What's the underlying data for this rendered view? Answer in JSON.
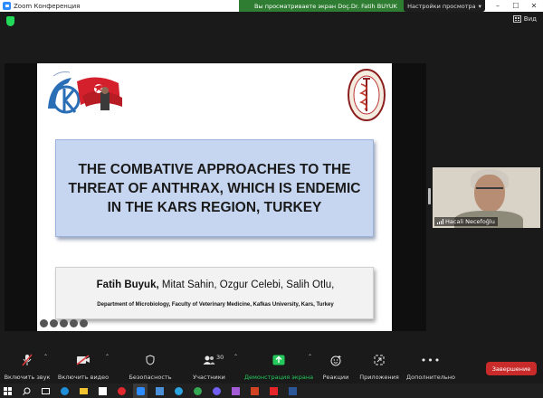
{
  "window": {
    "title": "Zoom Конференция",
    "share_banner": "Вы просматриваете экран Doç.Dr. Fatih BUYUK",
    "view_options": "Настройки просмотра",
    "view_button": "Вид"
  },
  "slide": {
    "title_lines": [
      "THE COMBATIVE APPROACHES TO THE",
      "THREAT OF ANTHRAX, WHICH IS ENDEMIC",
      "IN THE KARS REGION, TURKEY"
    ],
    "lead_author": "Fatih Buyuk,",
    "coauthors": " Mitat Sahin, Ozgur Celebi, Salih Otlu,",
    "department": "Department of Microbiology, Faculty of Veterinary Medicine, Kafkas University, Kars, Turkey"
  },
  "participant": {
    "name": "Hacali Necefoğlu"
  },
  "toolbar": {
    "audio": "Включить звук",
    "video": "Включить видео",
    "security": "Безопасность",
    "participants": "Участники",
    "participants_count": "30",
    "share": "Демонстрация экрана",
    "reactions": "Реакции",
    "apps": "Приложения",
    "more": "Дополнительно",
    "end": "Завершение"
  },
  "colors": {
    "share_green": "#2f7d32",
    "end_red": "#c92b2b",
    "title_box": "#c7d6f0"
  }
}
